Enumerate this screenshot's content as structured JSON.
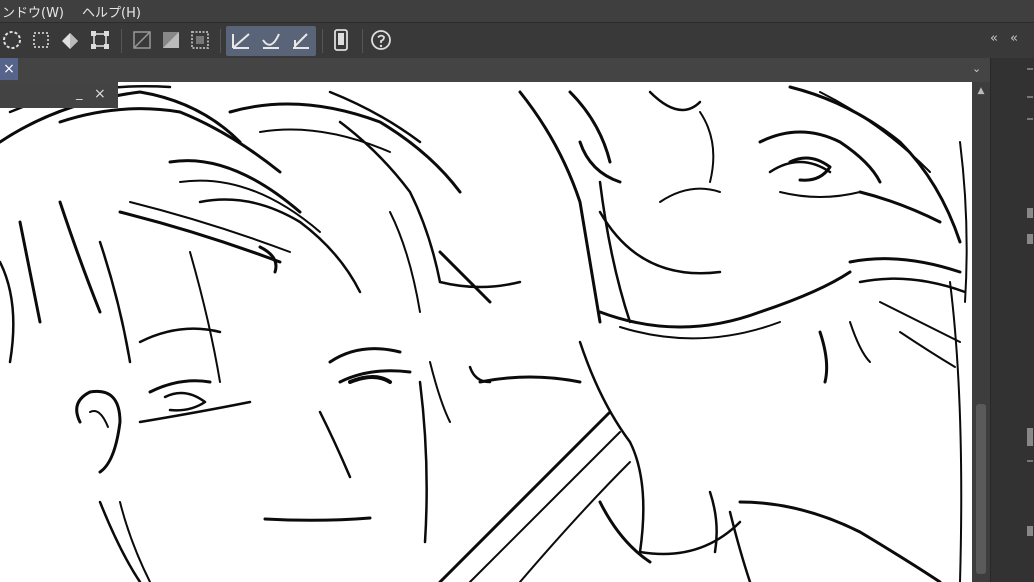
{
  "menu": {
    "items": [
      "ンドウ(W)",
      "ヘルプ(H)"
    ]
  },
  "toolbar": {
    "buttons": [
      "lasso-select-icon",
      "select-all-icon",
      "fill-bucket-icon",
      "transform-icon",
      "clear-outside-icon",
      "fill-selection-icon",
      "selection-border-icon",
      "ruler-straight-icon",
      "ruler-curve-icon",
      "ruler-special-icon",
      "device-icon",
      "help-icon"
    ],
    "collapse_glyph": "«",
    "active_color": "#5a6478"
  },
  "tab": {
    "close_glyph": "×",
    "chevron_glyph": "⌄"
  },
  "subwindow": {
    "minimize_glyph": "_",
    "close_glyph": "×"
  },
  "scrollbar": {
    "up_glyph": "▲"
  },
  "canvas": {
    "background": "#ffffff",
    "stroke": "#0b0b0b"
  }
}
